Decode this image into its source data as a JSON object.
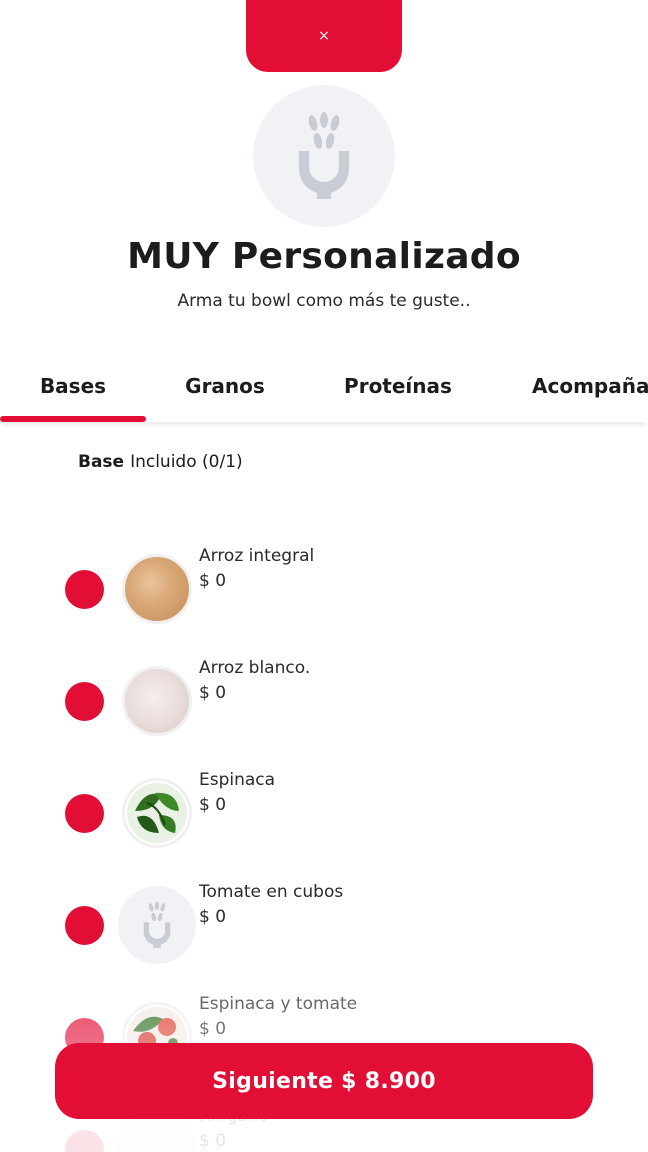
{
  "colors": {
    "accent": "#e30e35",
    "placeholder_bg": "#f1f2f6",
    "text": "#1c1c1c"
  },
  "close": {
    "label": "×"
  },
  "header": {
    "title": "MUY Personalizado",
    "subtitle": "Arma tu bowl como más te guste.."
  },
  "tabs": [
    {
      "label": "Bases",
      "active": true
    },
    {
      "label": "Granos",
      "active": false
    },
    {
      "label": "Proteínas",
      "active": false
    },
    {
      "label": "Acompañar",
      "active": false
    }
  ],
  "section": {
    "name": "Base",
    "status": "Incluido (0/1)"
  },
  "options": [
    {
      "name": "Arroz integral",
      "price": "$ 0",
      "image": "brown-rice"
    },
    {
      "name": "Arroz blanco.",
      "price": "$ 0",
      "image": "white-rice"
    },
    {
      "name": "Espinaca",
      "price": "$ 0",
      "image": "spinach"
    },
    {
      "name": "Tomate en cubos",
      "price": "$ 0",
      "image": "placeholder-logo"
    },
    {
      "name": "Espinaca y tomate",
      "price": "$ 0",
      "image": "spinach-tomato"
    },
    {
      "name": "Ringano",
      "price": "$ 0",
      "image": "placeholder-logo"
    }
  ],
  "footer": {
    "next_label": "Siguiente $ 8.900"
  }
}
